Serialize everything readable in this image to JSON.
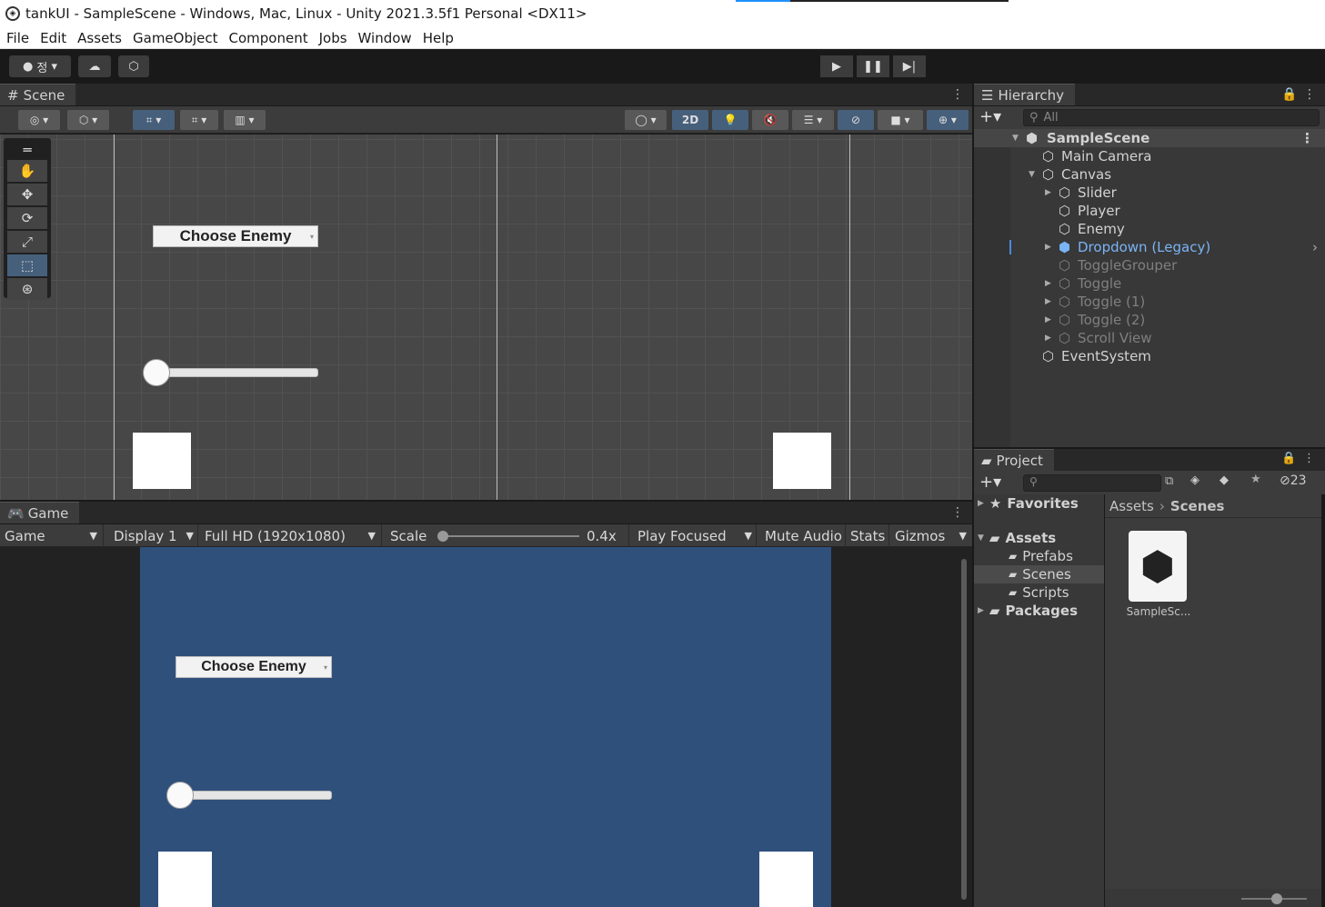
{
  "window": {
    "title": "tankUI - SampleScene - Windows, Mac, Linux - Unity 2021.3.5f1 Personal <DX11>"
  },
  "menu": [
    "File",
    "Edit",
    "Assets",
    "GameObject",
    "Component",
    "Jobs",
    "Window",
    "Help"
  ],
  "toolbar": {
    "account_label": "정",
    "play_icon": "play-icon",
    "pause_icon": "pause-icon",
    "step_icon": "step-icon"
  },
  "scene": {
    "tab": "Scene",
    "mode_2d": "2D",
    "dropdown_label": "Choose Enemy",
    "tools": [
      "hand-icon",
      "move-icon",
      "rotate-icon",
      "scale-icon",
      "rect-icon",
      "transform-icon"
    ]
  },
  "game": {
    "tab": "Game",
    "view_select": "Game",
    "display_select": "Display 1",
    "resolution_select": "Full HD (1920x1080)",
    "scale_label": "Scale",
    "scale_value": "0.4x",
    "play_mode_select": "Play Focused",
    "mute_audio": "Mute Audio",
    "stats": "Stats",
    "gizmos": "Gizmos",
    "dropdown_label": "Choose Enemy",
    "colors": {
      "canvas_bg": "#30507c"
    }
  },
  "hierarchy": {
    "tab": "Hierarchy",
    "search_placeholder": "All",
    "items": [
      {
        "label": "SampleScene",
        "depth": 0,
        "expanded": true,
        "style": "scene"
      },
      {
        "label": "Main Camera",
        "depth": 1
      },
      {
        "label": "Canvas",
        "depth": 1,
        "expanded": true
      },
      {
        "label": "Slider",
        "depth": 2,
        "collapsed": true
      },
      {
        "label": "Player",
        "depth": 2
      },
      {
        "label": "Enemy",
        "depth": 2
      },
      {
        "label": "Dropdown (Legacy)",
        "depth": 2,
        "collapsed": true,
        "style": "prefab"
      },
      {
        "label": "ToggleGrouper",
        "depth": 2,
        "style": "inactive"
      },
      {
        "label": "Toggle",
        "depth": 2,
        "collapsed": true,
        "style": "inactive"
      },
      {
        "label": "Toggle (1)",
        "depth": 2,
        "collapsed": true,
        "style": "inactive"
      },
      {
        "label": "Toggle (2)",
        "depth": 2,
        "collapsed": true,
        "style": "inactive"
      },
      {
        "label": "Scroll View",
        "depth": 2,
        "collapsed": true,
        "style": "inactive"
      },
      {
        "label": "EventSystem",
        "depth": 1
      }
    ]
  },
  "project": {
    "tab": "Project",
    "hidden_count": "23",
    "favorites": "Favorites",
    "assets": "Assets",
    "folders": [
      "Prefabs",
      "Scenes",
      "Scripts"
    ],
    "packages": "Packages",
    "breadcrumb": [
      "Assets",
      "Scenes"
    ],
    "files": [
      {
        "name": "SampleSc..."
      }
    ]
  }
}
